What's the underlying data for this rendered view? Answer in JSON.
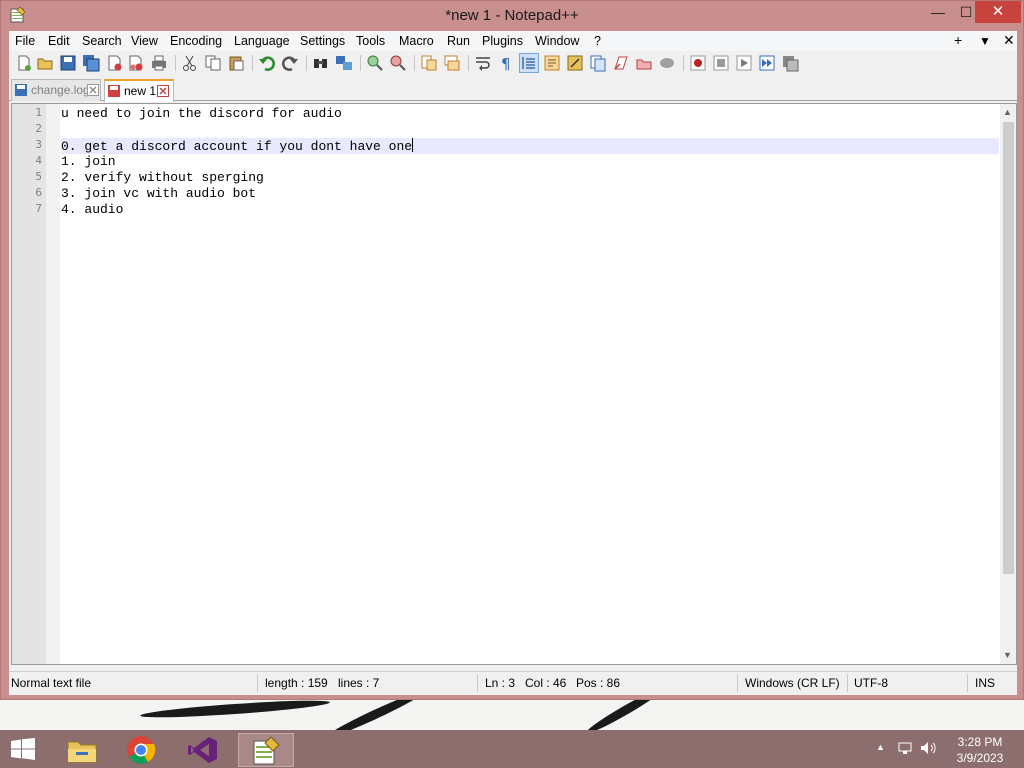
{
  "window": {
    "title": "*new 1 - Notepad++",
    "min_glyph": "—",
    "max_glyph": "☐",
    "close_glyph": "✕"
  },
  "menu": {
    "items": [
      "File",
      "Edit",
      "Search",
      "View",
      "Encoding",
      "Language",
      "Settings",
      "Tools",
      "Macro",
      "Run",
      "Plugins",
      "Window",
      "?"
    ],
    "right": [
      "+",
      "▼",
      "✕"
    ]
  },
  "toolbar": {
    "icons": [
      "new-file-icon",
      "open-file-icon",
      "save-icon",
      "save-all-icon",
      "close-icon",
      "close-all-icon",
      "print-icon",
      "cut-icon",
      "copy-icon",
      "paste-icon",
      "undo-icon",
      "redo-icon",
      "find-icon",
      "replace-icon",
      "zoom-in-icon",
      "zoom-out-icon",
      "sync-vertical-icon",
      "sync-horizontal-icon",
      "word-wrap-icon",
      "show-all-chars-icon",
      "indent-guide-icon",
      "user-language-icon",
      "doc-map-icon",
      "function-list-icon",
      "folder-as-workspace-icon",
      "monitoring-icon",
      "record-macro-icon",
      "stop-record-icon",
      "playback-macro-icon",
      "run-macro-multiple-icon",
      "save-macro-icon"
    ]
  },
  "tabs": [
    {
      "label": "change.log",
      "active": false
    },
    {
      "label": "new 1",
      "active": true
    }
  ],
  "editor": {
    "lines": [
      {
        "no": "1",
        "text": "u need to join the discord for audio"
      },
      {
        "no": "2",
        "text": ""
      },
      {
        "no": "3",
        "text": "0. get a discord account if you dont have one"
      },
      {
        "no": "4",
        "text": "1. join"
      },
      {
        "no": "5",
        "text": "2. verify without sperging"
      },
      {
        "no": "6",
        "text": "3. join vc with audio bot"
      },
      {
        "no": "7",
        "text": "4. audio"
      }
    ],
    "current_line": 3
  },
  "status": {
    "file_type": "Normal text file",
    "length": "length : 159",
    "lines": "lines : 7",
    "ln": "Ln : 3",
    "col": "Col : 46",
    "pos": "Pos : 86",
    "eol": "Windows (CR LF)",
    "encoding": "UTF-8",
    "mode": "INS"
  },
  "taskbar": {
    "apps": [
      "file-explorer-icon",
      "chrome-icon",
      "visual-studio-icon",
      "notepad-plus-plus-icon"
    ],
    "time": "3:28 PM",
    "date": "3/9/2023"
  },
  "colors": {
    "titlebar": "#c98f8f",
    "current_line": "#e8e8ff",
    "close_button": "#c7443c",
    "taskbar": "#8c6e6e"
  }
}
